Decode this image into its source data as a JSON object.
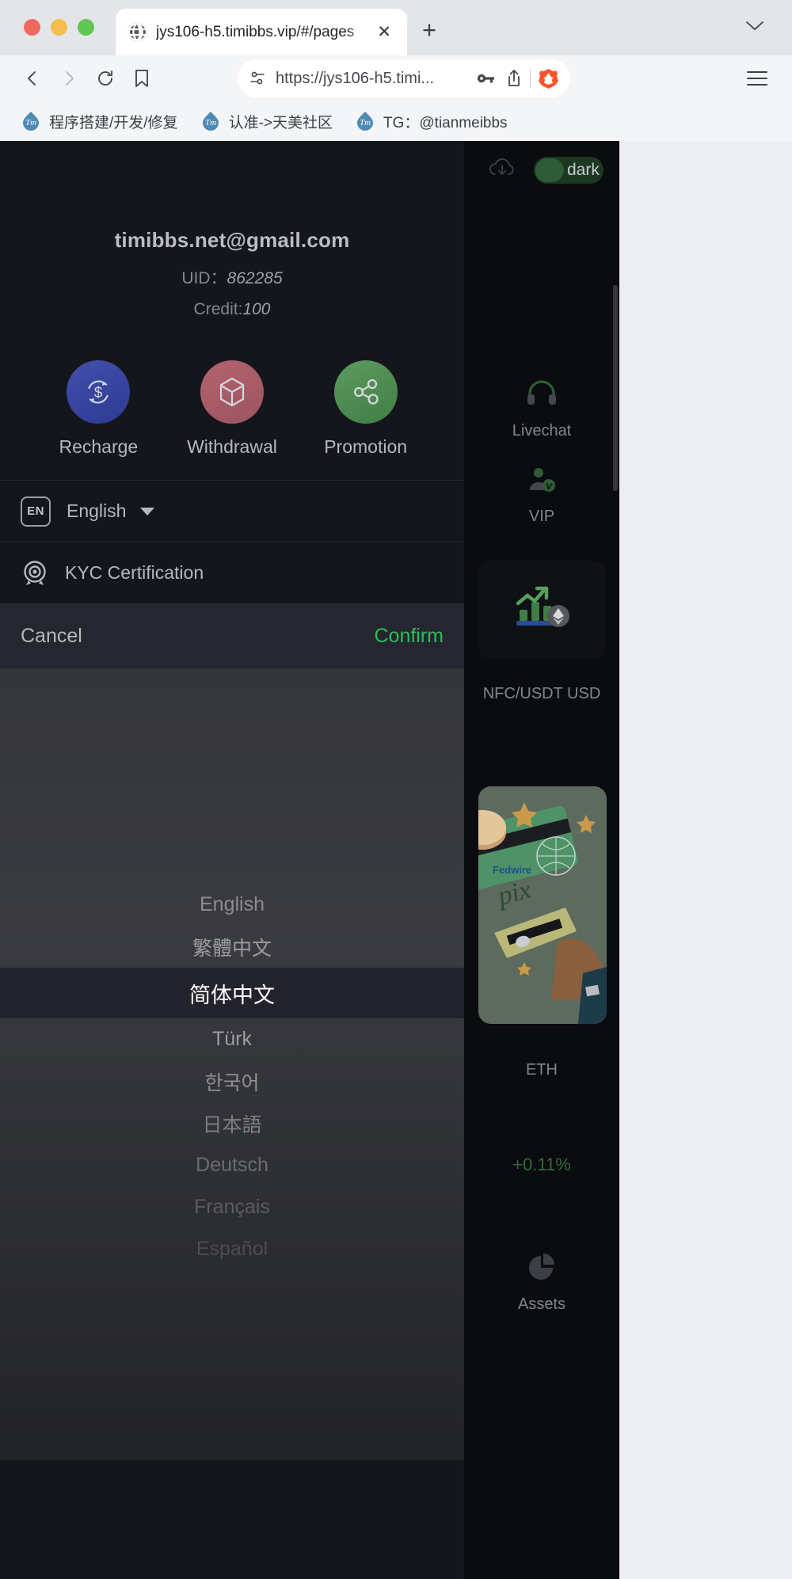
{
  "browser": {
    "tab": {
      "title": "jys106-h5.timibbs.vip/#/pages",
      "favicon_icon": "globe-icon",
      "close_icon": "close-icon"
    },
    "new_tab_icon": "plus-icon",
    "tab_list_icon": "chevron-down-icon",
    "back_icon": "back-arrow-icon",
    "forward_icon": "forward-arrow-icon",
    "reload_icon": "reload-icon",
    "bookmark_icon": "bookmark-icon",
    "url": "https://jys106-h5.timi...",
    "shield_icon": "site-settings-icon",
    "password_icon": "key-icon",
    "share_icon": "share-icon",
    "brave_icon": "brave-lion-icon",
    "menu_icon": "hamburger-menu-icon",
    "bookmarks": [
      {
        "label": "程序搭建/开发/修复",
        "icon": "tm-favicon"
      },
      {
        "label": "认准->天美社区",
        "icon": "tm-favicon"
      },
      {
        "label": "TG：@tianmeibbs",
        "icon": "tm-favicon"
      }
    ]
  },
  "app": {
    "rail": {
      "download_icon": "cloud-download-icon",
      "theme_toggle": {
        "label": "dark",
        "state": "on",
        "color": "#2f5c36"
      },
      "items": [
        {
          "label": "Livechat",
          "icon": "headset-icon"
        },
        {
          "label": "VIP",
          "icon": "vip-user-icon"
        }
      ],
      "promo_card": {
        "label": "NFC/USDT USD",
        "icon": "growth-chart-eth-icon"
      },
      "payment_card": {
        "icon": "pix-card-illustration"
      },
      "ticker": {
        "symbol": "ETH",
        "change": "+0.11%",
        "change_color": "#2f6b3a"
      },
      "assets": {
        "label": "Assets",
        "icon": "pie-chart-icon"
      }
    },
    "profile": {
      "email": "timibbs.net@gmail.com",
      "uid_label": "UID：",
      "uid_value": "862285",
      "credit_label": "Credit:",
      "credit_value": "100"
    },
    "actions": [
      {
        "label": "Recharge",
        "icon": "recharge-dollar-icon",
        "color": "#3b48a3"
      },
      {
        "label": "Withdrawal",
        "icon": "cube-box-icon",
        "color": "#ac5d6a"
      },
      {
        "label": "Promotion",
        "icon": "share-network-icon",
        "color": "#4d8a51"
      }
    ],
    "language_row": {
      "badge": "EN",
      "label": "English",
      "caret_icon": "caret-down-icon"
    },
    "kyc_row": {
      "label": "KYC Certification",
      "icon": "kyc-target-icon"
    },
    "picker": {
      "cancel_label": "Cancel",
      "confirm_label": "Confirm",
      "confirm_color": "#2fbd5a",
      "selected_index": 2,
      "options": [
        "English",
        "繁體中文",
        "简体中文",
        "Türk",
        "한국어",
        "日本語",
        "Deutsch",
        "Français",
        "Español"
      ]
    }
  }
}
